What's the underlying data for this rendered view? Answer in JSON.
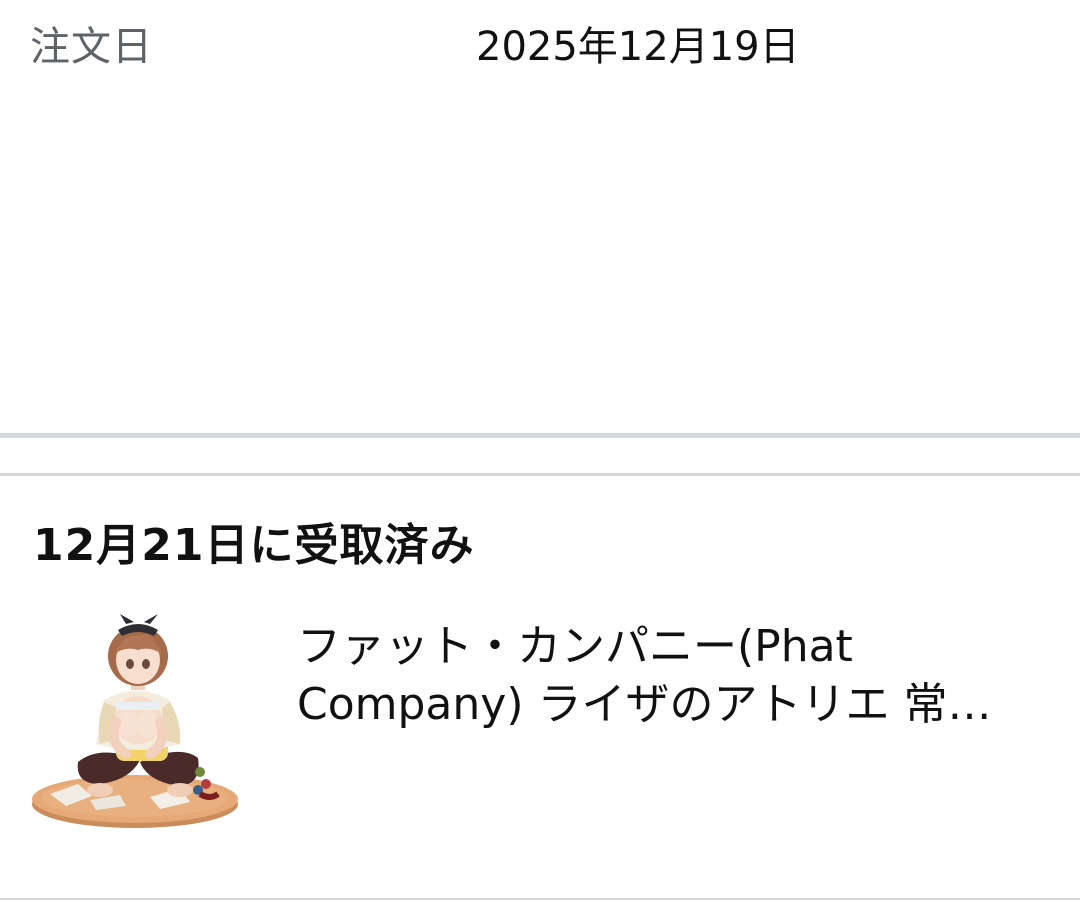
{
  "order": {
    "date_label": "注文日",
    "date_value": "2025年12月19日"
  },
  "shipment": {
    "status": "12月21日に受取済み",
    "item": {
      "title": "ファット・カンパニー(Phat Company) ライザのアトリエ 常…",
      "thumbnail_icon": "figure-product-thumbnail"
    }
  },
  "colors": {
    "label_gray": "#5f6368",
    "divider": "#d5d9dd",
    "text": "#111111",
    "background": "#ffffff"
  }
}
